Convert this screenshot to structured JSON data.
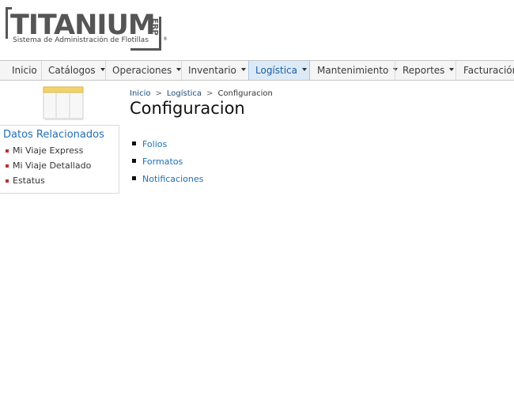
{
  "logo": {
    "wordmark": "TITANIUM",
    "suffix": "ERP",
    "tagline": "Sistema de Administración de Flotillas",
    "registered": "®"
  },
  "nav": {
    "items": [
      {
        "label": "Inicio",
        "has_menu": false
      },
      {
        "label": "Catálogos",
        "has_menu": true
      },
      {
        "label": "Operaciones",
        "has_menu": true
      },
      {
        "label": "Inventario",
        "has_menu": true
      },
      {
        "label": "Logística",
        "has_menu": true,
        "active": true
      },
      {
        "label": "Mantenimiento",
        "has_menu": true
      },
      {
        "label": "Reportes",
        "has_menu": true
      },
      {
        "label": "Facturación",
        "has_menu": false
      }
    ]
  },
  "sidebar": {
    "title": "Datos Relacionados",
    "links": [
      "Mi Viaje Express",
      "Mi Viaje Detallado",
      "Estatus"
    ]
  },
  "breadcrumb": {
    "items": [
      "Inicio",
      "Logística",
      "Configuracion"
    ],
    "separator": ">"
  },
  "page": {
    "title": "Configuracion",
    "links": [
      "Folios",
      "Formatos",
      "Notificaciones"
    ]
  },
  "colors": {
    "link_blue": "#1f6fb5",
    "active_tab_bg": "#dceaf7",
    "sidebar_bullet": "#b8312f"
  }
}
